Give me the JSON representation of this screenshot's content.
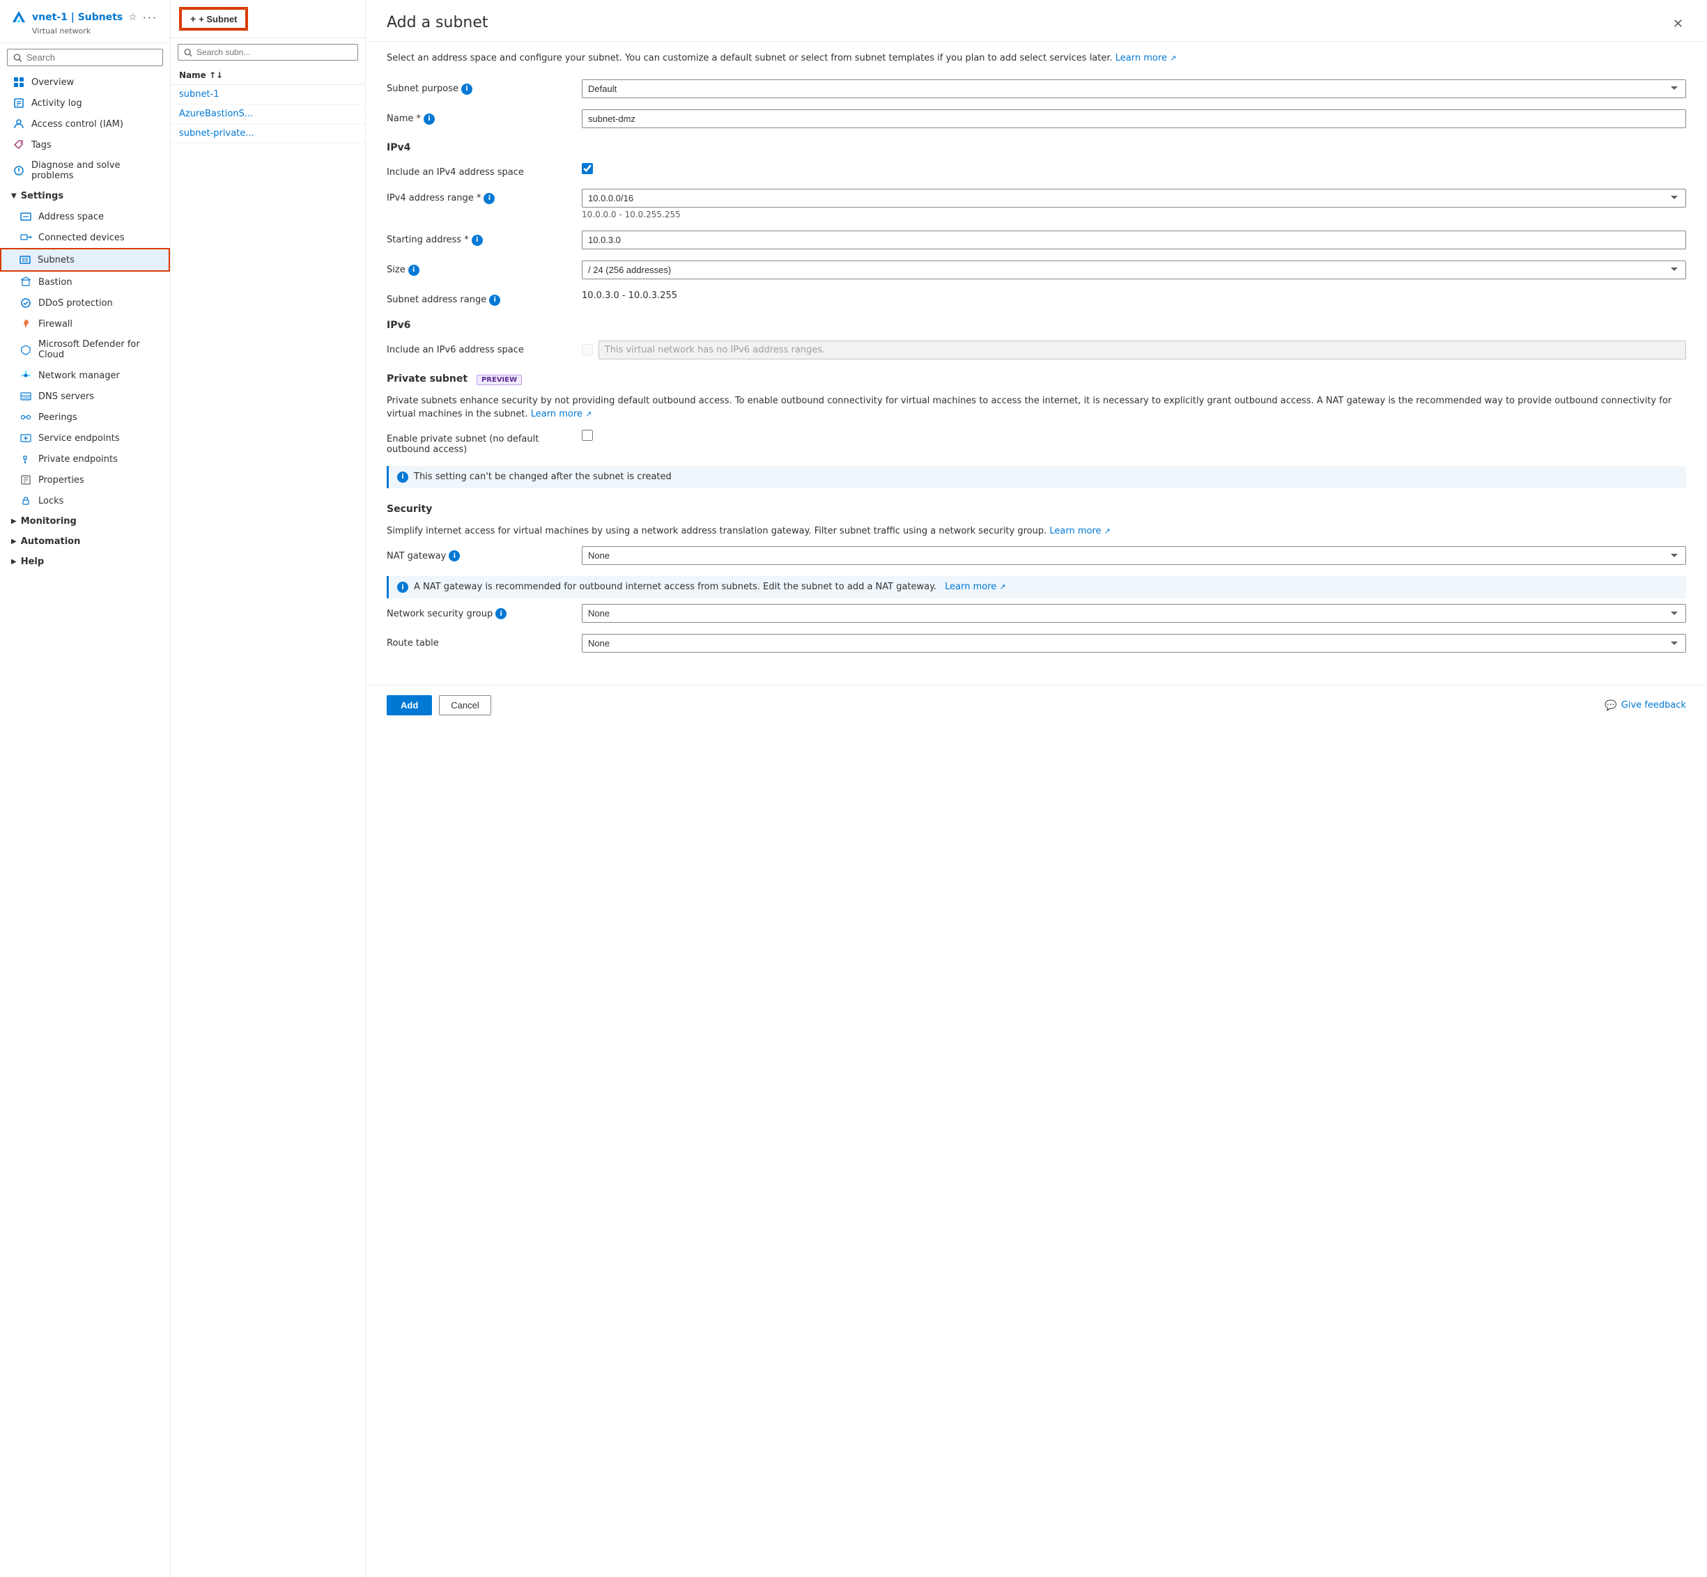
{
  "sidebar": {
    "title": "vnet-1 | Subnets",
    "subtitle": "Virtual network",
    "search_placeholder": "Search",
    "nav_items": [
      {
        "id": "overview",
        "label": "Overview",
        "icon": "overview"
      },
      {
        "id": "activity-log",
        "label": "Activity log",
        "icon": "activity"
      },
      {
        "id": "access-control",
        "label": "Access control (IAM)",
        "icon": "iam"
      },
      {
        "id": "tags",
        "label": "Tags",
        "icon": "tags"
      },
      {
        "id": "diagnose",
        "label": "Diagnose and solve problems",
        "icon": "diagnose"
      }
    ],
    "settings_section": "Settings",
    "settings_items": [
      {
        "id": "address-space",
        "label": "Address space",
        "icon": "address"
      },
      {
        "id": "connected-devices",
        "label": "Connected devices",
        "icon": "devices"
      },
      {
        "id": "subnets",
        "label": "Subnets",
        "icon": "subnets",
        "active": true
      },
      {
        "id": "bastion",
        "label": "Bastion",
        "icon": "bastion"
      },
      {
        "id": "ddos",
        "label": "DDoS protection",
        "icon": "ddos"
      },
      {
        "id": "firewall",
        "label": "Firewall",
        "icon": "firewall"
      },
      {
        "id": "defender",
        "label": "Microsoft Defender for Cloud",
        "icon": "defender"
      },
      {
        "id": "network-manager",
        "label": "Network manager",
        "icon": "network-manager"
      },
      {
        "id": "dns-servers",
        "label": "DNS servers",
        "icon": "dns"
      },
      {
        "id": "peerings",
        "label": "Peerings",
        "icon": "peerings"
      },
      {
        "id": "service-endpoints",
        "label": "Service endpoints",
        "icon": "service-ep"
      },
      {
        "id": "private-endpoints",
        "label": "Private endpoints",
        "icon": "private-ep"
      },
      {
        "id": "properties",
        "label": "Properties",
        "icon": "properties"
      },
      {
        "id": "locks",
        "label": "Locks",
        "icon": "locks"
      }
    ],
    "monitoring_section": "Monitoring",
    "automation_section": "Automation",
    "help_section": "Help"
  },
  "middle": {
    "add_subnet_btn": "+ Subnet",
    "search_placeholder": "Search subn...",
    "table_header": "Name ↑↓",
    "rows": [
      {
        "name": "subnet-1"
      },
      {
        "name": "AzureBastionS..."
      },
      {
        "name": "subnet-private..."
      }
    ]
  },
  "form": {
    "title": "Add a subnet",
    "description": "Select an address space and configure your subnet. You can customize a default subnet or select from subnet templates if you plan to add select services later.",
    "learn_more": "Learn more",
    "fields": {
      "subnet_purpose_label": "Subnet purpose",
      "subnet_purpose_value": "Default",
      "name_label": "Name *",
      "name_info": "i",
      "name_value": "subnet-dmz",
      "ipv4_section": "IPv4",
      "include_ipv4_label": "Include an IPv4 address space",
      "ipv4_range_label": "IPv4 address range *",
      "ipv4_range_info": "i",
      "ipv4_range_value": "10.0.0.0/16",
      "ipv4_range_sub": "10.0.0.0 - 10.0.255.255",
      "starting_address_label": "Starting address *",
      "starting_address_info": "i",
      "starting_address_value": "10.0.3.0",
      "size_label": "Size",
      "size_info": "i",
      "size_value": "/24 (256 addresses)",
      "subnet_address_range_label": "Subnet address range",
      "subnet_address_range_info": "i",
      "subnet_address_range_value": "10.0.3.0 - 10.0.3.255",
      "ipv6_section": "IPv6",
      "include_ipv6_label": "Include an IPv6 address space",
      "ipv6_disabled_placeholder": "This virtual network has no IPv6 address ranges.",
      "private_subnet_section": "Private subnet",
      "preview_badge": "PREVIEW",
      "private_subnet_desc": "Private subnets enhance security by not providing default outbound access. To enable outbound connectivity for virtual machines to access the internet, it is necessary to explicitly grant outbound access. A NAT gateway is the recommended way to provide outbound connectivity for virtual machines in the subnet.",
      "private_subnet_learn_more": "Learn more",
      "enable_private_subnet_label": "Enable private subnet (no default outbound access)",
      "private_subnet_info": "This setting can't be changed after the subnet is created",
      "security_section": "Security",
      "security_desc": "Simplify internet access for virtual machines by using a network address translation gateway. Filter subnet traffic using a network security group.",
      "security_learn_more": "Learn more",
      "nat_gateway_label": "NAT gateway",
      "nat_gateway_info": "i",
      "nat_gateway_value": "None",
      "nat_info_text": "A NAT gateway is recommended for outbound internet access from subnets. Edit the subnet to add a NAT gateway.",
      "nat_learn_more": "Learn more",
      "nsg_label": "Network security group",
      "nsg_info": "i",
      "nsg_value": "None",
      "route_table_label": "Route table",
      "route_table_value": "None"
    },
    "add_btn": "Add",
    "cancel_btn": "Cancel",
    "give_feedback": "Give feedback"
  }
}
